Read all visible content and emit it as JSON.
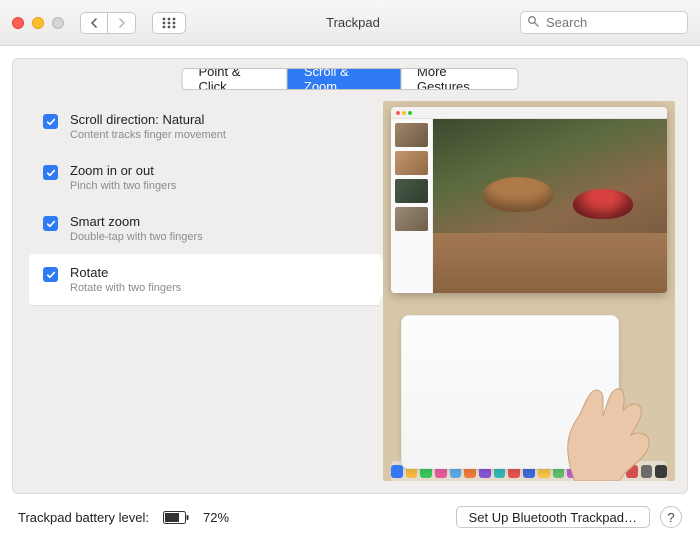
{
  "window": {
    "title": "Trackpad"
  },
  "search": {
    "placeholder": "Search"
  },
  "tabs": [
    {
      "label": "Point & Click",
      "active": false
    },
    {
      "label": "Scroll & Zoom",
      "active": true
    },
    {
      "label": "More Gestures",
      "active": false
    }
  ],
  "options": [
    {
      "title": "Scroll direction: Natural",
      "subtitle": "Content tracks finger movement",
      "checked": true,
      "selected": false
    },
    {
      "title": "Zoom in or out",
      "subtitle": "Pinch with two fingers",
      "checked": true,
      "selected": false
    },
    {
      "title": "Smart zoom",
      "subtitle": "Double-tap with two fingers",
      "checked": true,
      "selected": false
    },
    {
      "title": "Rotate",
      "subtitle": "Rotate with two fingers",
      "checked": true,
      "selected": true
    }
  ],
  "footer": {
    "battery_label": "Trackpad battery level:",
    "battery_percent": "72%",
    "setup_button": "Set Up Bluetooth Trackpad…",
    "help": "?"
  },
  "dock_colors": [
    "#3478f6",
    "#f5b942",
    "#39c559",
    "#e85c9b",
    "#5aa8e6",
    "#f07a3c",
    "#8754d1",
    "#33b8b5",
    "#e55151",
    "#3f6ad8",
    "#f6c145",
    "#5fbf6b",
    "#b85cd6",
    "#4aa3d9",
    "#e9893d",
    "#50c1bd",
    "#d14f4f",
    "#6a6a6a",
    "#3a3a3a"
  ]
}
